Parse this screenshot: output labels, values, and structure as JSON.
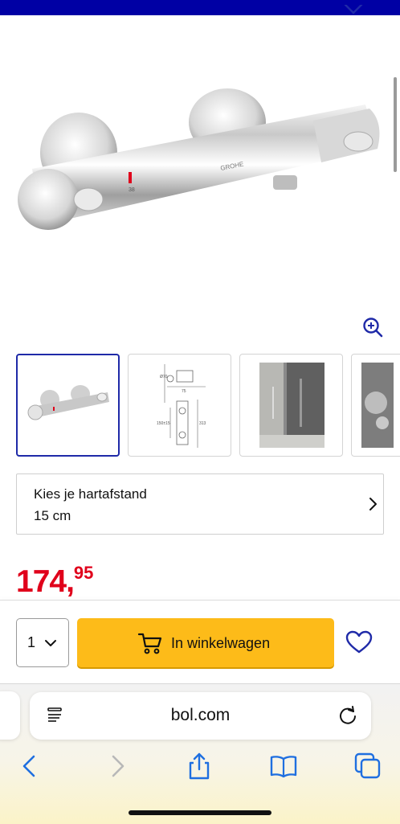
{
  "page": {
    "accent_color": "#0000a4",
    "price_color": "#e0001b",
    "cta_color": "#fdbb19",
    "link_color": "#1f2aa8"
  },
  "header": {
    "wishlist_icon": "heart-outline-icon"
  },
  "gallery": {
    "hero_alt": "GROHE thermostat",
    "brand_mark": "GROHE",
    "scale_marks": "38",
    "zoom_icon": "zoom-in-icon",
    "thumbnails": [
      {
        "name": "product-photo",
        "active": true
      },
      {
        "name": "technical-drawing",
        "active": false,
        "labels": [
          "Ø70",
          "75",
          "150±15",
          "313"
        ]
      },
      {
        "name": "shower-room-photo",
        "active": false
      },
      {
        "name": "detail-photo",
        "active": false
      }
    ]
  },
  "selector": {
    "label": "Kies je hartafstand",
    "value": "15 cm",
    "icon": "chevron-right-icon"
  },
  "price": {
    "integer": "174",
    "separator": ",",
    "decimals": "95"
  },
  "buy_bar": {
    "quantity": "1",
    "cart_button_label": "In winkelwagen",
    "cart_icon": "cart-icon",
    "wishlist_icon": "heart-outline-icon"
  },
  "browser": {
    "url": "bol.com",
    "toolbar": [
      "back-icon",
      "forward-icon",
      "share-icon",
      "bookmarks-icon",
      "tabs-icon"
    ]
  }
}
